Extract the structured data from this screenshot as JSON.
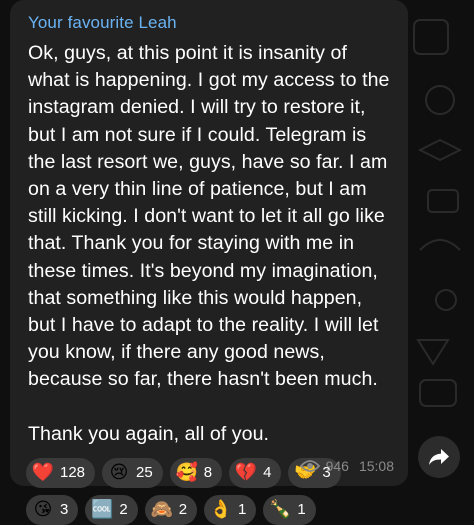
{
  "message": {
    "sender": "Your favourite Leah",
    "paragraph1": "Ok, guys, at this point it is insanity of what is happening. I got my access to the instagram denied. I will try to restore it, but I am not sure if I could. Telegram is the last resort we, guys, have so far. I am on a very thin line of patience, but I am still kicking. I don't want to let it all go like that. Thank you for staying with me in these times. It's beyond my imagination, that something like this would happen, but I have to adapt to the reality. I will let you know, if there any good news, because so far, there hasn't been much.",
    "paragraph2": "Thank you again, all of you."
  },
  "reactions": [
    {
      "emoji": "heart",
      "glyph": "❤️",
      "count": "128"
    },
    {
      "emoji": "crying-face",
      "glyph": "😢",
      "count": "25"
    },
    {
      "emoji": "smiling-face-with-hearts",
      "glyph": "🥰",
      "count": "8"
    },
    {
      "emoji": "broken-heart",
      "glyph": "💔",
      "count": "4"
    },
    {
      "emoji": "handshake",
      "glyph": "🤝",
      "count": "3"
    },
    {
      "emoji": "kissing-face",
      "glyph": "😘",
      "count": "3"
    },
    {
      "emoji": "cool-button",
      "glyph": "🆒",
      "count": "2"
    },
    {
      "emoji": "see-no-evil-monkey",
      "glyph": "🙈",
      "count": "2"
    },
    {
      "emoji": "ok-hand",
      "glyph": "👌",
      "count": "1"
    },
    {
      "emoji": "champagne",
      "glyph": "🍾",
      "count": "1"
    }
  ],
  "meta": {
    "views": "946",
    "time": "15:08"
  },
  "colors": {
    "sender": "#6ab3f3",
    "bubble": "#212121",
    "reaction_bg": "#3a3a3a",
    "meta": "#8a8a8a"
  }
}
